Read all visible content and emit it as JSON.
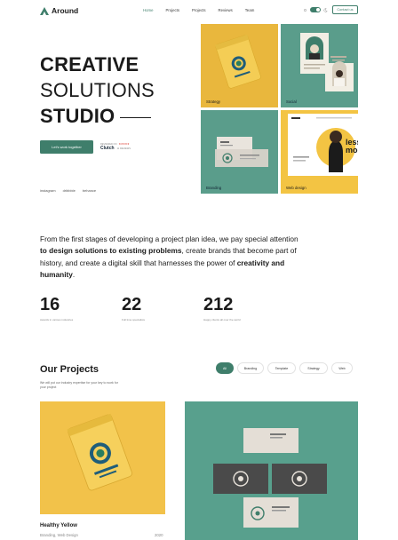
{
  "header": {
    "logo": "Around",
    "nav": [
      {
        "label": "Home",
        "active": true
      },
      {
        "label": "Projects",
        "active": false
      },
      {
        "label": "Projects",
        "active": false
      },
      {
        "label": "Reviews",
        "active": false
      },
      {
        "label": "Team",
        "active": false
      }
    ],
    "contact_label": "Contact us"
  },
  "hero": {
    "line1": "CREATIVE",
    "line2": "SOLUTIONS",
    "line3": "STUDIO",
    "cta": "Let's work together",
    "clutch": {
      "reviewed_on": "REVIEWED ON",
      "stars": "★★★★★",
      "name": "Clutch",
      "reviews": "11 REVIEWS"
    },
    "socials": [
      "instagram",
      "dribbble",
      "behance"
    ],
    "tiles": [
      {
        "label": "Strategy",
        "color": "#e9b73d"
      },
      {
        "label": "Social",
        "color": "#5a9d8b"
      },
      {
        "label": "Branding",
        "color": "#5a9d8b"
      },
      {
        "label": "Web design",
        "color": "#f3c443"
      }
    ],
    "web_tile_text": [
      "less",
      "more"
    ]
  },
  "about": {
    "p1": "From the first stages of developing a project plan idea, we pay special attention ",
    "b1": "to design solutions to existing problems",
    "p2": ", create brands that become part of history, and create a digital skill that harnesses the power of ",
    "b2": "creativity and humanity",
    "p3": "."
  },
  "stats": [
    {
      "value": "16",
      "label": "Awards in various industries"
    },
    {
      "value": "22",
      "label": "Full time specialists"
    },
    {
      "value": "212",
      "label": "Happy clients all over the world"
    }
  ],
  "projects": {
    "title": "Our Projects",
    "subtitle": "We will put our industry expertise for your key to work for your project",
    "filters": [
      {
        "label": "All",
        "active": true
      },
      {
        "label": "Branding",
        "active": false
      },
      {
        "label": "Template",
        "active": false
      },
      {
        "label": "Strategy",
        "active": false
      },
      {
        "label": "Web",
        "active": false
      }
    ],
    "cards": [
      {
        "title": "Healthy Yellow",
        "tags": "Branding, Web Design",
        "year": "2020"
      }
    ]
  },
  "colors": {
    "accent": "#3f7e6b",
    "yellow": "#f2c24a",
    "teal": "#58a08d"
  }
}
